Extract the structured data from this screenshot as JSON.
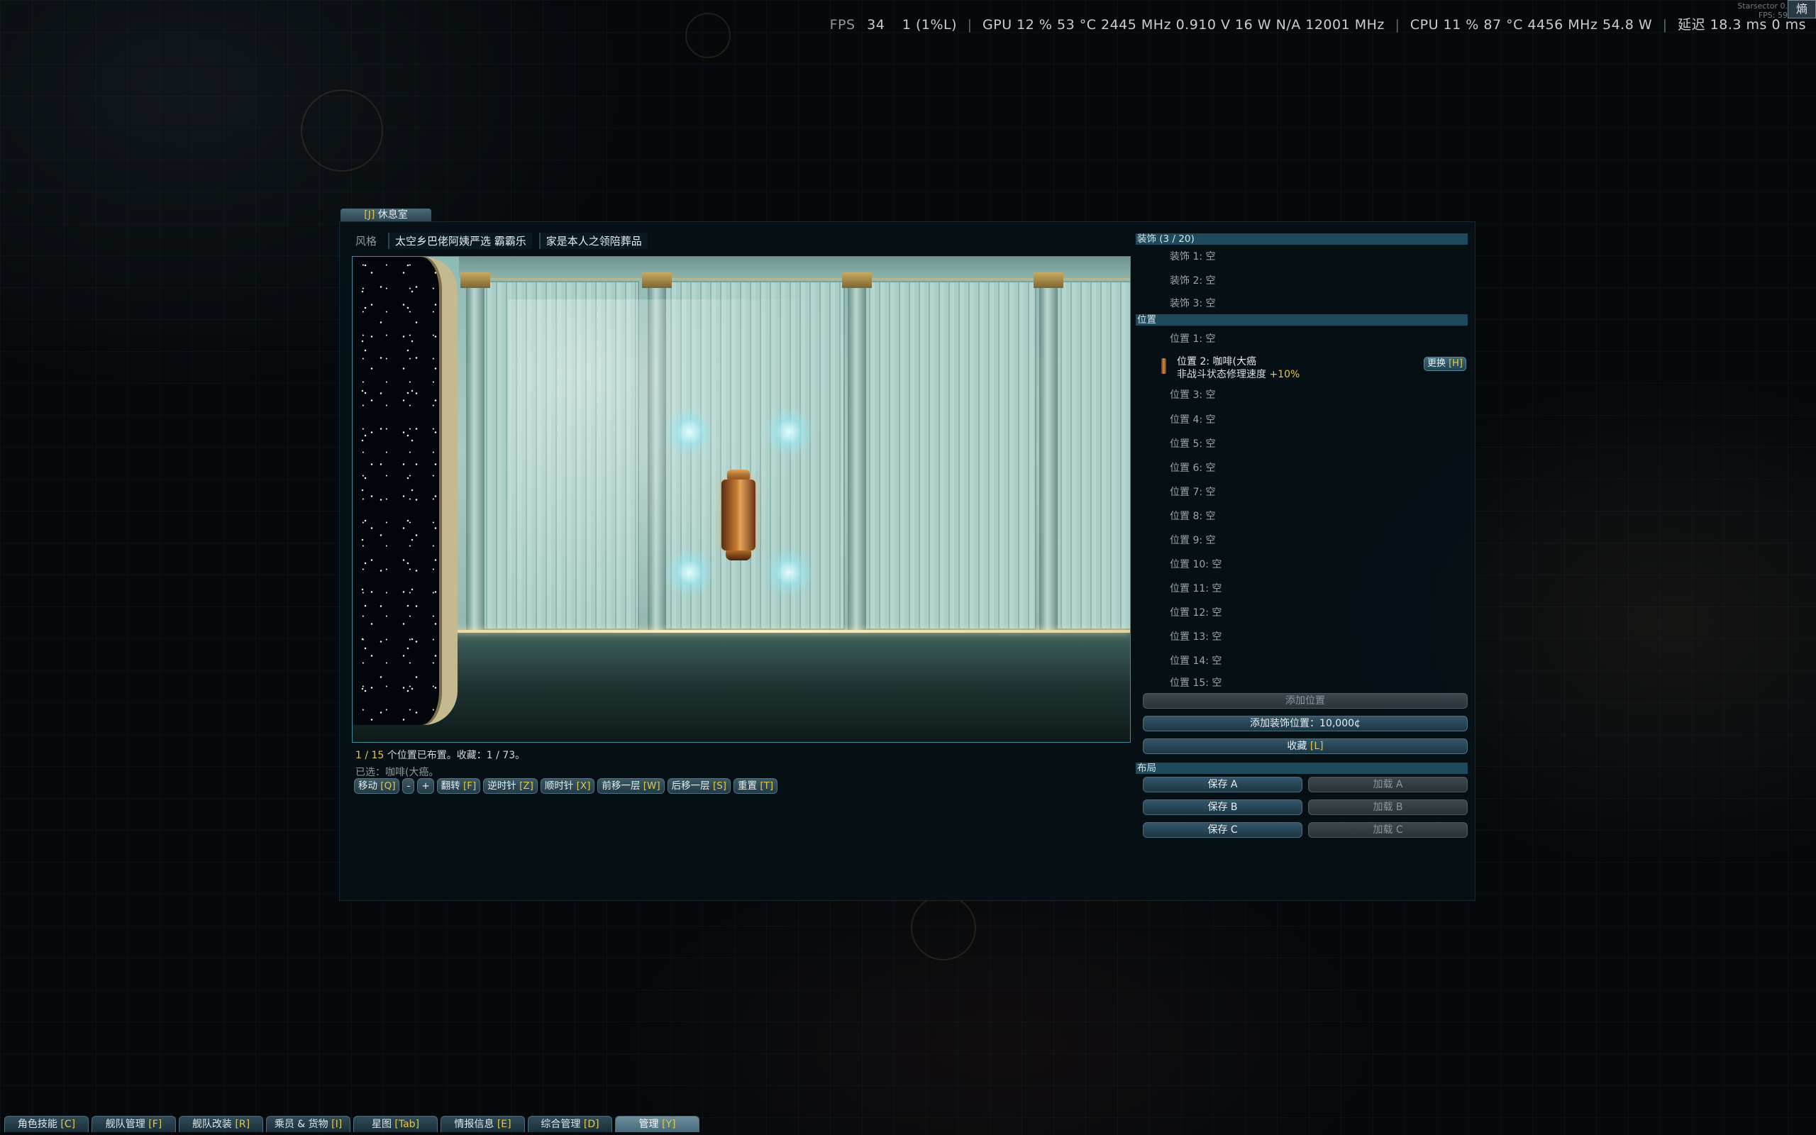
{
  "perf": {
    "fps_label": "FPS",
    "fps_value": "34",
    "low": "1 (1%L)",
    "gpu": "GPU  12 %  53 °C  2445 MHz  0.910 V   16 W   N/A   12001 MHz",
    "cpu": "CPU  11 %  87 °C  4456 MHz  54.8 W",
    "latency": "延迟  18.3 ms  0 ms"
  },
  "corner": {
    "line1": "Starsector 0.",
    "line2": "FPS: 59",
    "button": "熵"
  },
  "window": {
    "tab_hotkey": "[J]",
    "tab_label": "休息室"
  },
  "style": {
    "label": "风格",
    "chips": [
      "太空乡巴佬阿姨严选 霸霸乐",
      "家是本人之领陪葬品"
    ]
  },
  "status": {
    "count": "1 / 15",
    "text": " 个位置已布置。收藏：1 / 73。",
    "selected": "已选：咖啡(大癌。"
  },
  "actions": [
    {
      "label": "移动 ",
      "hk": "[Q]"
    },
    {
      "label": "-",
      "hk": ""
    },
    {
      "label": "+",
      "hk": ""
    },
    {
      "label": "翻转 ",
      "hk": "[F]"
    },
    {
      "label": "逆时针 ",
      "hk": "[Z]"
    },
    {
      "label": "顺时针 ",
      "hk": "[X]"
    },
    {
      "label": "前移一层 ",
      "hk": "[W]"
    },
    {
      "label": "后移一层 ",
      "hk": "[S]"
    },
    {
      "label": "重置 ",
      "hk": "[T]"
    }
  ],
  "decor": {
    "header": "装饰  (3 / 20)",
    "items": [
      "装饰 1: 空",
      "装饰 2: 空",
      "装饰 3: 空"
    ]
  },
  "positions": {
    "header": "位置",
    "item1": "位置 1: 空",
    "filled_title": "位置 2: 咖啡(大癌",
    "filled_desc": "非战斗状态修理速度 ",
    "filled_bonus": "+10%",
    "replace_label": "更换 ",
    "replace_hk": "[H]",
    "rest": [
      "位置 3: 空",
      "位置 4: 空",
      "位置 5: 空",
      "位置 6: 空",
      "位置 7: 空",
      "位置 8: 空",
      "位置 9: 空",
      "位置 10: 空",
      "位置 11: 空",
      "位置 12: 空",
      "位置 13: 空",
      "位置 14: 空",
      "位置 15: 空"
    ]
  },
  "buttons": {
    "add_position": "添加位置",
    "add_decor": "添加装饰位置：10,000¢",
    "favorite": "收藏 ",
    "favorite_hk": "[L]"
  },
  "layout_section": {
    "header": "布局",
    "save_a": "保存 A",
    "load_a": "加载 A",
    "save_b": "保存 B",
    "load_b": "加载 B",
    "save_c": "保存 C",
    "load_c": "加载 C"
  },
  "bottombar": [
    {
      "label": "角色技能 ",
      "hk": "[C]"
    },
    {
      "label": "舰队管理 ",
      "hk": "[F]"
    },
    {
      "label": "舰队改装 ",
      "hk": "[R]"
    },
    {
      "label": "乘员 & 货物 ",
      "hk": "[I]"
    },
    {
      "label": "星图 ",
      "hk": "[Tab]"
    },
    {
      "label": "情报信息 ",
      "hk": "[E]"
    },
    {
      "label": "综合管理 ",
      "hk": "[D]"
    },
    {
      "label": "管理 ",
      "hk": "[Y]"
    }
  ],
  "colors": {
    "accent_teal": "#1e4a5c",
    "hotkey_yellow": "#e2c84a",
    "scene_border": "#3e8ea0"
  }
}
